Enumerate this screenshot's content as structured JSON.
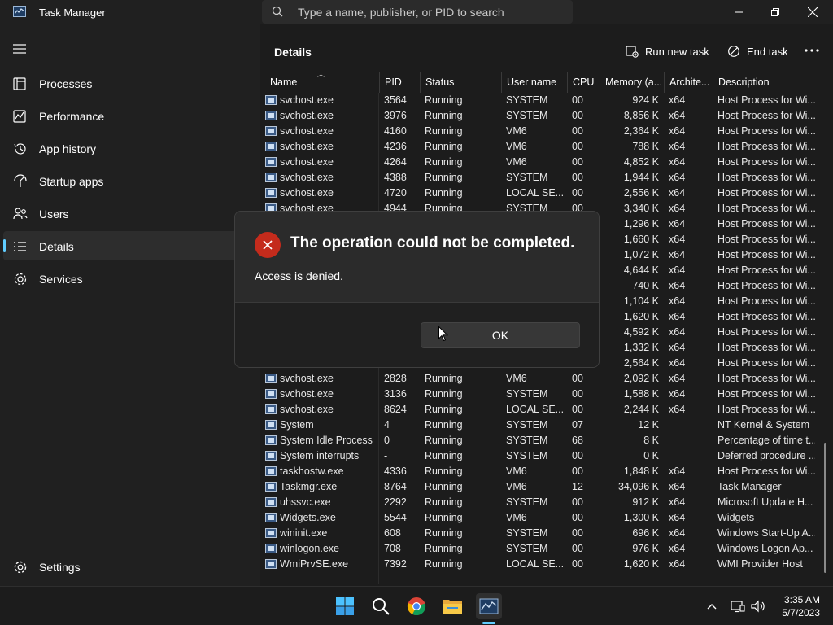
{
  "app": {
    "title": "Task Manager"
  },
  "search": {
    "placeholder": "Type a name, publisher, or PID to search"
  },
  "sidebar": {
    "items": [
      {
        "label": "Processes"
      },
      {
        "label": "Performance"
      },
      {
        "label": "App history"
      },
      {
        "label": "Startup apps"
      },
      {
        "label": "Users"
      },
      {
        "label": "Details"
      },
      {
        "label": "Services"
      }
    ],
    "settings_label": "Settings",
    "active_index": 5
  },
  "details": {
    "title": "Details",
    "run_new_task_label": "Run new task",
    "end_task_label": "End task",
    "columns": [
      "Name",
      "PID",
      "Status",
      "User name",
      "CPU",
      "Memory (a...",
      "Archite...",
      "Description"
    ],
    "rows_top": [
      [
        "svchost.exe",
        "3564",
        "Running",
        "SYSTEM",
        "00",
        "924 K",
        "x64",
        "Host Process for Wi..."
      ],
      [
        "svchost.exe",
        "3976",
        "Running",
        "SYSTEM",
        "00",
        "8,856 K",
        "x64",
        "Host Process for Wi..."
      ],
      [
        "svchost.exe",
        "4160",
        "Running",
        "VM6",
        "00",
        "2,364 K",
        "x64",
        "Host Process for Wi..."
      ],
      [
        "svchost.exe",
        "4236",
        "Running",
        "VM6",
        "00",
        "788 K",
        "x64",
        "Host Process for Wi..."
      ],
      [
        "svchost.exe",
        "4264",
        "Running",
        "VM6",
        "00",
        "4,852 K",
        "x64",
        "Host Process for Wi..."
      ],
      [
        "svchost.exe",
        "4388",
        "Running",
        "SYSTEM",
        "00",
        "1,944 K",
        "x64",
        "Host Process for Wi..."
      ],
      [
        "svchost.exe",
        "4720",
        "Running",
        "LOCAL SE...",
        "00",
        "2,556 K",
        "x64",
        "Host Process for Wi..."
      ],
      [
        "svchost.exe",
        "4944",
        "Running",
        "SYSTEM",
        "00",
        "3,340 K",
        "x64",
        "Host Process for Wi..."
      ]
    ],
    "rows_hidden": [
      [
        "",
        "",
        "",
        "",
        "",
        "1,296 K",
        "x64",
        "Host Process for Wi..."
      ],
      [
        "",
        "",
        "",
        "",
        "",
        "1,660 K",
        "x64",
        "Host Process for Wi..."
      ],
      [
        "",
        "",
        "",
        "",
        "",
        "1,072 K",
        "x64",
        "Host Process for Wi..."
      ],
      [
        "",
        "",
        "",
        "",
        "",
        "4,644 K",
        "x64",
        "Host Process for Wi..."
      ],
      [
        "",
        "",
        "",
        "",
        "",
        "740 K",
        "x64",
        "Host Process for Wi..."
      ],
      [
        "",
        "",
        "",
        "",
        "",
        "1,104 K",
        "x64",
        "Host Process for Wi..."
      ],
      [
        "",
        "",
        "",
        "",
        "",
        "1,620 K",
        "x64",
        "Host Process for Wi..."
      ],
      [
        "",
        "",
        "",
        "",
        "",
        "4,592 K",
        "x64",
        "Host Process for Wi..."
      ],
      [
        "",
        "",
        "",
        "",
        "",
        "1,332 K",
        "x64",
        "Host Process for Wi..."
      ],
      [
        "",
        "",
        "",
        "",
        "",
        "2,564 K",
        "x64",
        "Host Process for Wi..."
      ]
    ],
    "rows_bottom": [
      [
        "svchost.exe",
        "2828",
        "Running",
        "VM6",
        "00",
        "2,092 K",
        "x64",
        "Host Process for Wi..."
      ],
      [
        "svchost.exe",
        "3136",
        "Running",
        "SYSTEM",
        "00",
        "1,588 K",
        "x64",
        "Host Process for Wi..."
      ],
      [
        "svchost.exe",
        "8624",
        "Running",
        "LOCAL SE...",
        "00",
        "2,244 K",
        "x64",
        "Host Process for Wi..."
      ],
      [
        "System",
        "4",
        "Running",
        "SYSTEM",
        "07",
        "12 K",
        "",
        "NT Kernel & System"
      ],
      [
        "System Idle Process",
        "0",
        "Running",
        "SYSTEM",
        "68",
        "8 K",
        "",
        "Percentage of time t..."
      ],
      [
        "System interrupts",
        "-",
        "Running",
        "SYSTEM",
        "00",
        "0 K",
        "",
        "Deferred procedure ..."
      ],
      [
        "taskhostw.exe",
        "4336",
        "Running",
        "VM6",
        "00",
        "1,848 K",
        "x64",
        "Host Process for Wi..."
      ],
      [
        "Taskmgr.exe",
        "8764",
        "Running",
        "VM6",
        "12",
        "34,096 K",
        "x64",
        "Task Manager"
      ],
      [
        "uhssvc.exe",
        "2292",
        "Running",
        "SYSTEM",
        "00",
        "912 K",
        "x64",
        "Microsoft Update H..."
      ],
      [
        "Widgets.exe",
        "5544",
        "Running",
        "VM6",
        "00",
        "1,300 K",
        "x64",
        "Widgets"
      ],
      [
        "wininit.exe",
        "608",
        "Running",
        "SYSTEM",
        "00",
        "696 K",
        "x64",
        "Windows Start-Up A..."
      ],
      [
        "winlogon.exe",
        "708",
        "Running",
        "SYSTEM",
        "00",
        "976 K",
        "x64",
        "Windows Logon Ap..."
      ],
      [
        "WmiPrvSE.exe",
        "7392",
        "Running",
        "LOCAL SE...",
        "00",
        "1,620 K",
        "x64",
        "WMI Provider Host"
      ]
    ]
  },
  "dialog": {
    "title": "The operation could not be completed.",
    "message": "Access is denied.",
    "ok_label": "OK"
  },
  "taskbar": {
    "time": "3:35 AM",
    "date": "5/7/2023"
  },
  "colors": {
    "accent": "#60cdff",
    "error": "#c42b1c",
    "background": "#202020"
  }
}
